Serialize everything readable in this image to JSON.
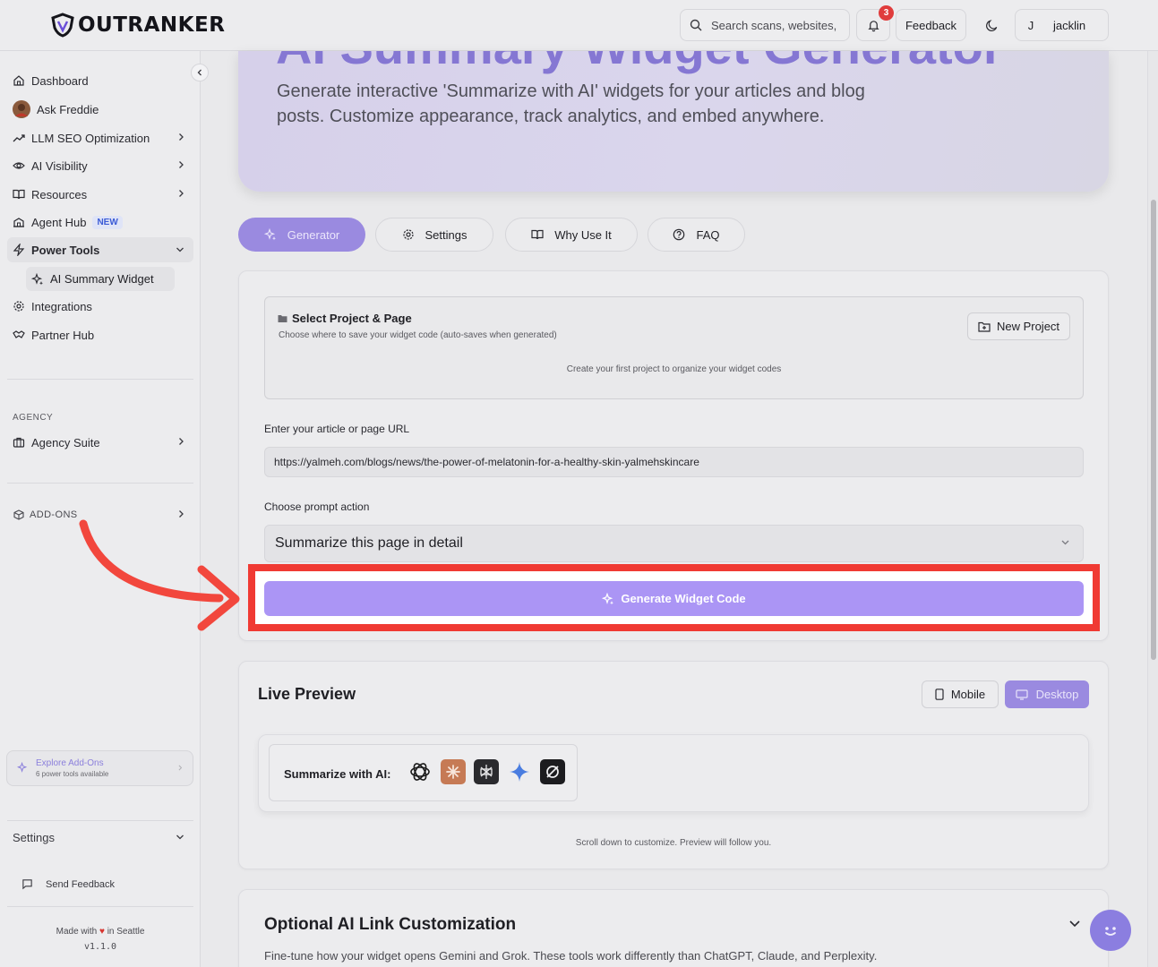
{
  "app": {
    "logo_text": "OUTRANKER"
  },
  "topbar": {
    "search_placeholder": "Search scans, websites,",
    "notification_count": "3",
    "feedback_label": "Feedback",
    "user_initial": "J",
    "user_name": "jacklin"
  },
  "sidebar": {
    "items": [
      {
        "label": "Dashboard",
        "icon": "home-icon"
      },
      {
        "label": "Ask Freddie",
        "icon": "avatar"
      },
      {
        "label": "LLM SEO Optimization",
        "icon": "trend-icon"
      },
      {
        "label": "AI Visibility",
        "icon": "eye-icon"
      },
      {
        "label": "Resources",
        "icon": "book-icon"
      },
      {
        "label": "Agent Hub",
        "icon": "building-icon",
        "badge": "NEW"
      },
      {
        "label": "Power Tools",
        "icon": "zap-icon"
      },
      {
        "label": "Integrations",
        "icon": "gear-icon"
      },
      {
        "label": "Partner Hub",
        "icon": "handshake-icon"
      }
    ],
    "sub_item": "AI Summary Widget",
    "agency_label": "AGENCY",
    "agency_item": "Agency Suite",
    "addons_label": "ADD-ONS",
    "explore_title": "Explore Add-Ons",
    "explore_sub": "6 power tools available",
    "settings_label": "Settings",
    "send_feedback": "Send Feedback",
    "made_with_pre": "Made with",
    "made_with_post": "in Seattle",
    "version": "v1.1.0"
  },
  "hero": {
    "title": "AI Summary Widget Generator",
    "description": "Generate interactive 'Summarize with AI' widgets for your articles and blog posts. Customize appearance, track analytics, and embed anywhere."
  },
  "tabs": [
    {
      "label": "Generator",
      "active": true
    },
    {
      "label": "Settings"
    },
    {
      "label": "Why Use It"
    },
    {
      "label": "FAQ"
    }
  ],
  "generator": {
    "project_title": "Select Project & Page",
    "project_subtitle": "Choose where to save your widget code (auto-saves when generated)",
    "new_project_label": "New Project",
    "project_empty": "Create your first project to organize your widget codes",
    "url_label": "Enter your article or page URL",
    "url_value": "https://yalmeh.com/blogs/news/the-power-of-melatonin-for-a-healthy-skin-yalmehskincare",
    "prompt_label": "Choose prompt action",
    "prompt_value": "Summarize this page in detail",
    "generate_label": "Generate Widget Code"
  },
  "preview": {
    "title": "Live Preview",
    "mobile_label": "Mobile",
    "desktop_label": "Desktop",
    "widget_label": "Summarize with AI:",
    "hint": "Scroll down to customize. Preview will follow you."
  },
  "optional": {
    "title": "Optional AI Link Customization",
    "description": "Fine-tune how your widget opens Gemini and Grok. These tools work differently than ChatGPT, Claude, and Perplexity."
  },
  "colors": {
    "accent": "#9a8ae0",
    "generate_button": "#ab95f5",
    "highlight": "#f03a33",
    "annotation_arrow": "#f2473d"
  }
}
